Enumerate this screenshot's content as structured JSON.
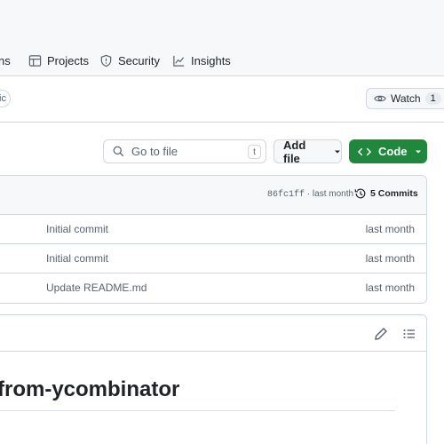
{
  "nav": {
    "partial_tab": "ns",
    "tabs": [
      {
        "label": "Projects",
        "icon": "table-icon"
      },
      {
        "label": "Security",
        "icon": "shield-icon"
      },
      {
        "label": "Insights",
        "icon": "graph-icon"
      }
    ]
  },
  "repo_header": {
    "visibility_partial": "lic",
    "watch_label": "Watch",
    "watch_count": "1"
  },
  "toolbar": {
    "search_placeholder": "Go to file",
    "search_shortcut": "t",
    "add_file_label": "Add file",
    "code_label": "Code"
  },
  "latest_commit": {
    "hash": "86fc1ff",
    "time": "last month",
    "commits_label": "5 Commits"
  },
  "files": [
    {
      "message": "Initial commit",
      "time": "last month"
    },
    {
      "message": "Initial commit",
      "time": "last month"
    },
    {
      "message": "Update README.md",
      "time": "last month"
    }
  ],
  "readme": {
    "heading_partial": "from-ycombinator"
  },
  "colors": {
    "code_button": "#1f883d",
    "border": "#d0d7de",
    "header_bg": "#f6f8fa"
  }
}
